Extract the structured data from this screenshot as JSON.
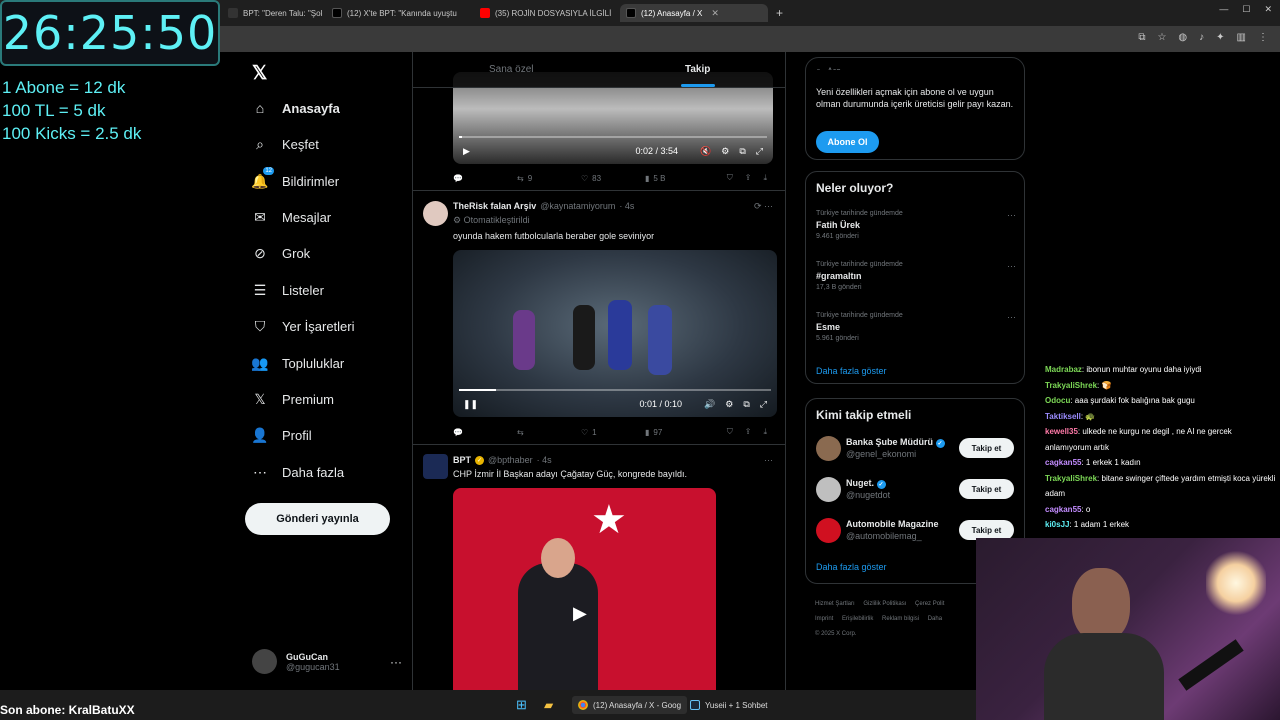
{
  "overlay": {
    "timer": "26:25:50",
    "rates": [
      "1 Abone = 12 dk",
      "100 TL = 5 dk",
      "100 Kicks = 2.5 dk"
    ],
    "last_sub": "Son abone: KralBatuXX"
  },
  "browser": {
    "tabs": [
      {
        "label": "BPT: \"Deren Talu: \"Şok",
        "color": "#e7e9ea"
      },
      {
        "label": "(12) X'te BPT: \"Kanında uyuştu",
        "color": "#e7e9ea"
      },
      {
        "label": "(35) ROJİN DOSYASIYLA İLGİLİ",
        "color": "#ff0000"
      },
      {
        "label": "(12) Anasayfa / X",
        "color": "#e7e9ea"
      }
    ]
  },
  "nav": {
    "items": [
      {
        "label": "Anasayfa",
        "icon": "home-icon",
        "glyph": "⌂"
      },
      {
        "label": "Keşfet",
        "icon": "search-icon",
        "glyph": "⌕"
      },
      {
        "label": "Bildirimler",
        "icon": "bell-icon",
        "glyph": "🔔",
        "badge": "12"
      },
      {
        "label": "Mesajlar",
        "icon": "mail-icon",
        "glyph": "✉"
      },
      {
        "label": "Grok",
        "icon": "grok-icon",
        "glyph": "⊘"
      },
      {
        "label": "Listeler",
        "icon": "list-icon",
        "glyph": "☰"
      },
      {
        "label": "Yer İşaretleri",
        "icon": "bookmark-icon",
        "glyph": "⛉"
      },
      {
        "label": "Topluluklar",
        "icon": "communities-icon",
        "glyph": "👥"
      },
      {
        "label": "Premium",
        "icon": "x-premium-icon",
        "glyph": "𝕏"
      },
      {
        "label": "Profil",
        "icon": "profile-icon",
        "glyph": "👤"
      },
      {
        "label": "Daha fazla",
        "icon": "more-circle-icon",
        "glyph": "⋯"
      }
    ],
    "post_button": "Gönderi yayınla",
    "account": {
      "name": "GuGuCan",
      "handle": "@gugucan31"
    }
  },
  "feed": {
    "tabs": {
      "for_you": "Sana özel",
      "following": "Takip"
    },
    "post1": {
      "time": "0:02 / 3:54",
      "progress": 0.01,
      "stats": {
        "replies": "",
        "reposts": "9",
        "likes": "83",
        "views": "5 B"
      }
    },
    "post2": {
      "name": "TheRisk falan Arşiv",
      "handle": "@kaynatamiyorum",
      "age": "· 4s",
      "automated": "Otomatikleştirildi",
      "text": "oyunda hakem futbolcularla beraber gole seviniyor",
      "time": "0:01 / 0:10",
      "progress": 0.12,
      "stats": {
        "replies": "",
        "reposts": "",
        "likes": "1",
        "views": "97"
      }
    },
    "post3": {
      "name": "BPT",
      "handle": "@bpthaber",
      "age": "· 4s",
      "text": "CHP İzmir İl Başkan adayı Çağatay Güç, kongrede bayıldı."
    }
  },
  "sidebar": {
    "search_placeholder": "Ara",
    "subscribe": {
      "text": "Yeni özellikleri açmak için abone ol ve uygun olman durumunda içerik üreticisi gelir payı kazan.",
      "button": "Abone Ol"
    },
    "trends_title": "Neler oluyor?",
    "trends": [
      {
        "context": "Türkiye tarihinde gündemde",
        "topic": "Fatih Ürek",
        "posts": "9.461 gönderi"
      },
      {
        "context": "Türkiye tarihinde gündemde",
        "topic": "#gramaltın",
        "posts": "17,3 B gönderi"
      },
      {
        "context": "Türkiye tarihinde gündemde",
        "topic": "Esme",
        "posts": "5.961 gönderi"
      }
    ],
    "show_more": "Daha fazla göster",
    "who_title": "Kimi takip etmeli",
    "who": [
      {
        "name": "Banka Şube Müdürü",
        "handle": "@genel_ekonomi",
        "button": "Takip et"
      },
      {
        "name": "Nuget.",
        "handle": "@nugetdot",
        "button": "Takip et"
      },
      {
        "name": "Automobile Magazine",
        "handle": "@automobilemag_",
        "button": "Takip et"
      }
    ],
    "footer_links": [
      "Hizmet Şartları",
      "Gizlilik Politikası",
      "Çerez Polit",
      "Imprint",
      "Erişilebilirlik",
      "Reklam bilgisi",
      "Daha",
      "© 2025 X Corp."
    ]
  },
  "chat": [
    {
      "user": "Madrabaz",
      "msg": ": ibonun muhtar oyunu daha iyiydi",
      "color": "#7dd957"
    },
    {
      "user": "TrakyaliShrek",
      "msg": ": 🍞",
      "color": "#7dd957"
    },
    {
      "user": "Odocu",
      "msg": ": aaa şurdaki fok balığına bak gugu",
      "color": "#7dd957"
    },
    {
      "user": "Taktiksell",
      "msg": ": 🐢",
      "color": "#9b8cff"
    },
    {
      "user": "kewell35",
      "msg": ": ulkede ne kurgu ne degil , ne AI ne gercek anlamıyorum artık",
      "color": "#ff7aa8"
    },
    {
      "user": "cagkan55",
      "msg": ": 1 erkek 1 kadın",
      "color": "#c38cff"
    },
    {
      "user": "TrakyaliShrek",
      "msg": ": bitane swinger çiftede yardım etmişti koca yürekli adam",
      "color": "#7dd957"
    },
    {
      "user": "cagkan55",
      "msg": ": o",
      "color": "#c38cff"
    },
    {
      "user": "ki0sJJ",
      "msg": ": 1 adam 1 erkek",
      "color": "#5ef0f5"
    }
  ],
  "taskbar": {
    "chrome_label": "(12) Anasayfa / X - Goog",
    "steam_label": "Yuseii + 1 Sohbet"
  },
  "colors": {
    "accent": "#1d9bf0",
    "timer": "#5ef0f5"
  }
}
